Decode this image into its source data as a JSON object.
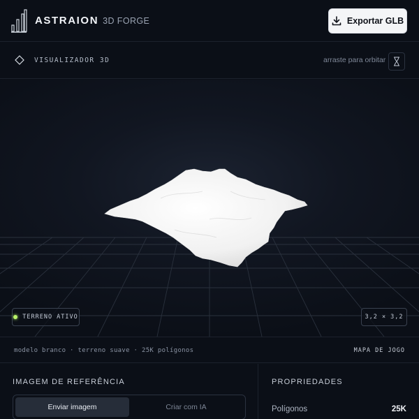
{
  "brand": {
    "name": "ASTRAION",
    "sub": "3D FORGE"
  },
  "toolbar": {
    "export_label": "Exportar GLB",
    "export_icon": "download-icon"
  },
  "viewer": {
    "title": "VISUALIZADOR 3D",
    "hint": "arraste para orbitar",
    "status_label": "TERRENO ATIVO",
    "status_color": "#b9f36a",
    "dimensions": "3,2 × 3,2"
  },
  "info": {
    "description": "modelo branco · terreno suave · 25K polígonos",
    "mode": "MAPA DE JOGO"
  },
  "reference": {
    "title": "IMAGEM DE REFERÊNCIA",
    "tabs": [
      {
        "label": "Enviar imagem",
        "active": true
      },
      {
        "label": "Criar com IA",
        "active": false
      }
    ]
  },
  "properties": {
    "title": "PROPRIEDADES",
    "rows": [
      {
        "label": "Polígonos",
        "value": "25K"
      }
    ]
  },
  "colors": {
    "background": "#0b0f17",
    "accent": "#b9f36a",
    "button": "#f4f5f7"
  }
}
